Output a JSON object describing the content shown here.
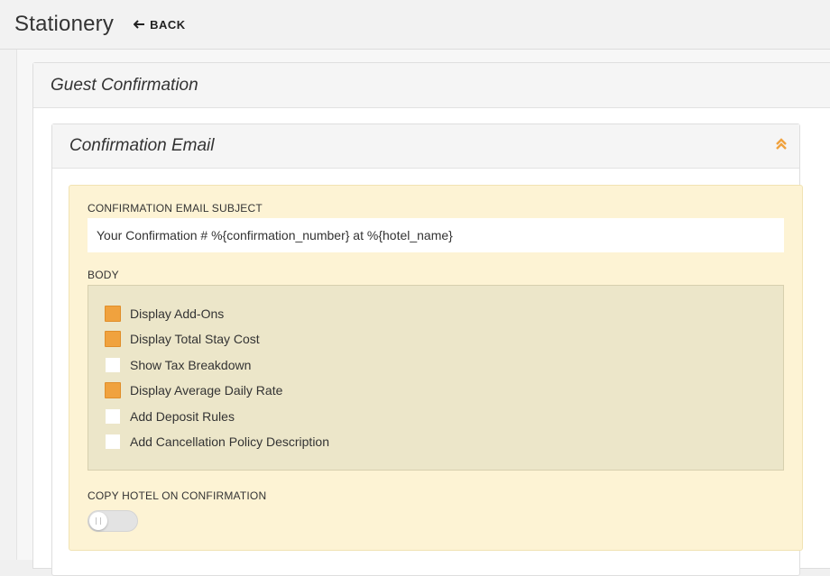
{
  "header": {
    "title": "Stationery",
    "back_label": "BACK"
  },
  "guest_panel": {
    "title": "Guest Confirmation"
  },
  "email_card": {
    "title": "Confirmation Email",
    "collapse_icon": "chevron-double-up-icon",
    "accent_color": "#f0a23e"
  },
  "subject": {
    "label": "CONFIRMATION EMAIL SUBJECT",
    "value": "Your Confirmation # %{confirmation_number} at %{hotel_name}"
  },
  "body": {
    "label": "BODY",
    "options": [
      {
        "label": "Display Add-Ons",
        "checked": true
      },
      {
        "label": "Display Total Stay Cost",
        "checked": true
      },
      {
        "label": "Show Tax Breakdown",
        "checked": false
      },
      {
        "label": "Display Average Daily Rate",
        "checked": true
      },
      {
        "label": "Add Deposit Rules",
        "checked": false
      },
      {
        "label": "Add Cancellation Policy Description",
        "checked": false
      }
    ]
  },
  "copy_hotel": {
    "label": "COPY HOTEL ON CONFIRMATION",
    "enabled": false
  }
}
